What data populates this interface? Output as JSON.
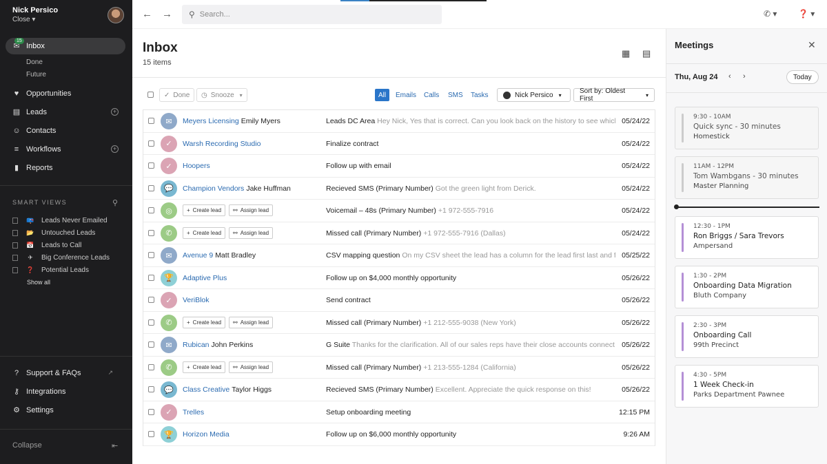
{
  "user": {
    "name": "Nick Persico",
    "org": "Close ▾"
  },
  "sidebar": {
    "inbox": {
      "label": "Inbox",
      "badge": "15"
    },
    "inbox_sub": [
      "Done",
      "Future"
    ],
    "items": [
      {
        "label": "Opportunities",
        "icon": "opportunities-icon"
      },
      {
        "label": "Leads",
        "icon": "leads-icon"
      },
      {
        "label": "Contacts",
        "icon": "contacts-icon"
      },
      {
        "label": "Workflows",
        "icon": "workflows-icon"
      },
      {
        "label": "Reports",
        "icon": "reports-icon"
      }
    ],
    "smart_views_title": "SMART VIEWS",
    "smart_views": [
      {
        "emoji": "📪",
        "label": "Leads Never Emailed"
      },
      {
        "emoji": "📂",
        "label": "Untouched Leads"
      },
      {
        "emoji": "📅",
        "label": "Leads to Call"
      },
      {
        "emoji": "✈",
        "label": "Big Conference Leads"
      },
      {
        "emoji": "❓",
        "label": "Potential Leads"
      }
    ],
    "show_all": "Show all",
    "bottom": [
      {
        "label": "Support & FAQs",
        "icon": "help-icon"
      },
      {
        "label": "Integrations",
        "icon": "integrations-icon"
      },
      {
        "label": "Settings",
        "icon": "settings-icon"
      }
    ],
    "collapse": "Collapse"
  },
  "search": {
    "placeholder": "Search..."
  },
  "inbox": {
    "title": "Inbox",
    "count": "15 items",
    "toolbar": {
      "done": "Done",
      "snooze": "Snooze",
      "filters": [
        "All",
        "Emails",
        "Calls",
        "SMS",
        "Tasks"
      ],
      "user_filter": "Nick Persico",
      "sort": "Sort by: Oldest First"
    },
    "create_lead": "Create lead",
    "assign_lead": "Assign lead",
    "rows": [
      {
        "type": "email",
        "lead": "Meyers Licensing",
        "contact": "Emily Myers",
        "subject": "Leads DC Area",
        "preview": "Hey Nick, Yes that is correct. Can you look back on the history to see which",
        "date": "05/24/22"
      },
      {
        "type": "task",
        "lead": "Warsh Recording Studio",
        "contact": "",
        "subject": "Finalize contract",
        "preview": "",
        "date": "05/24/22"
      },
      {
        "type": "task",
        "lead": "Hoopers",
        "contact": "",
        "subject": "Follow up with email",
        "preview": "",
        "date": "05/24/22"
      },
      {
        "type": "sms",
        "lead": "Champion Vendors",
        "contact": "Jake Huffman",
        "subject": "Recieved SMS (Primary Number)",
        "preview": "Got the green light from Derick.",
        "date": "05/24/22"
      },
      {
        "type": "voicemail",
        "lead": "",
        "contact": "",
        "actions": true,
        "subject": "Voicemail – 48s (Primary Number)",
        "preview": "+1 972-555-7916",
        "date": "05/24/22"
      },
      {
        "type": "call",
        "lead": "",
        "contact": "",
        "actions": true,
        "subject": "Missed call (Primary Number)",
        "preview": "+1 972-555-7916 (Dallas)",
        "date": "05/24/22"
      },
      {
        "type": "email",
        "lead": "Avenue 9",
        "contact": "Matt Bradley",
        "subject": "CSV mapping question",
        "preview": "On my CSV sheet the lead has a column for the lead first last and fu",
        "date": "05/25/22"
      },
      {
        "type": "opportunity",
        "lead": "Adaptive Plus",
        "contact": "",
        "subject": "Follow up on $4,000 monthly opportunity",
        "preview": "",
        "date": "05/26/22"
      },
      {
        "type": "task",
        "lead": "VeriBlok",
        "contact": "",
        "subject": "Send contract",
        "preview": "",
        "date": "05/26/22"
      },
      {
        "type": "call",
        "lead": "",
        "contact": "",
        "actions": true,
        "subject": "Missed call (Primary Number)",
        "preview": "+1 212-555-9038 (New York)",
        "date": "05/26/22"
      },
      {
        "type": "email",
        "lead": "Rubican",
        "contact": "John Perkins",
        "subject": "G Suite",
        "preview": "Thanks for the clarification. All of our sales reps have their close accounts connect",
        "date": "05/26/22"
      },
      {
        "type": "call",
        "lead": "",
        "contact": "",
        "actions": true,
        "subject": "Missed call (Primary Number)",
        "preview": "+1 213-555-1284 (California)",
        "date": "05/26/22"
      },
      {
        "type": "sms",
        "lead": "Class Creative",
        "contact": "Taylor Higgs",
        "subject": "Recieved SMS (Primary Number)",
        "preview": "Excellent. Appreciate the quick response on this!",
        "date": "05/26/22"
      },
      {
        "type": "task",
        "lead": "Trelles",
        "contact": "",
        "subject": "Setup onboarding meeting",
        "preview": "",
        "date": "12:15 PM"
      },
      {
        "type": "opportunity",
        "lead": "Horizon Media",
        "contact": "",
        "subject": "Follow up on $6,000 monthly opportunity",
        "preview": "",
        "date": "9:26 AM"
      }
    ]
  },
  "meetings": {
    "title": "Meetings",
    "date": "Thu, Aug 24",
    "today": "Today",
    "items": [
      {
        "time": "9:30 - 10AM",
        "title": "Quick sync - 30 minutes",
        "sub": "Homestick",
        "past": true,
        "bar": "#cccccc"
      },
      {
        "time": "11AM - 12PM",
        "title": "Tom Wambgans - 30 minutes",
        "sub": "Master Planning",
        "past": true,
        "bar": "#cccccc"
      },
      {
        "time": "12:30 - 1PM",
        "title": "Ron Briggs / Sara Trevors",
        "sub": "Ampersand",
        "past": false,
        "bar": "#b48fd6"
      },
      {
        "time": "1:30 - 2PM",
        "title": "Onboarding Data Migration",
        "sub": "Bluth Company",
        "past": false,
        "bar": "#b48fd6"
      },
      {
        "time": "2:30 - 3PM",
        "title": "Onboarding Call",
        "sub": "99th Precinct",
        "past": false,
        "bar": "#b48fd6"
      },
      {
        "time": "4:30 - 5PM",
        "title": "1 Week Check-in",
        "sub": "Parks Department Pawnee",
        "past": false,
        "bar": "#b48fd6"
      }
    ]
  }
}
